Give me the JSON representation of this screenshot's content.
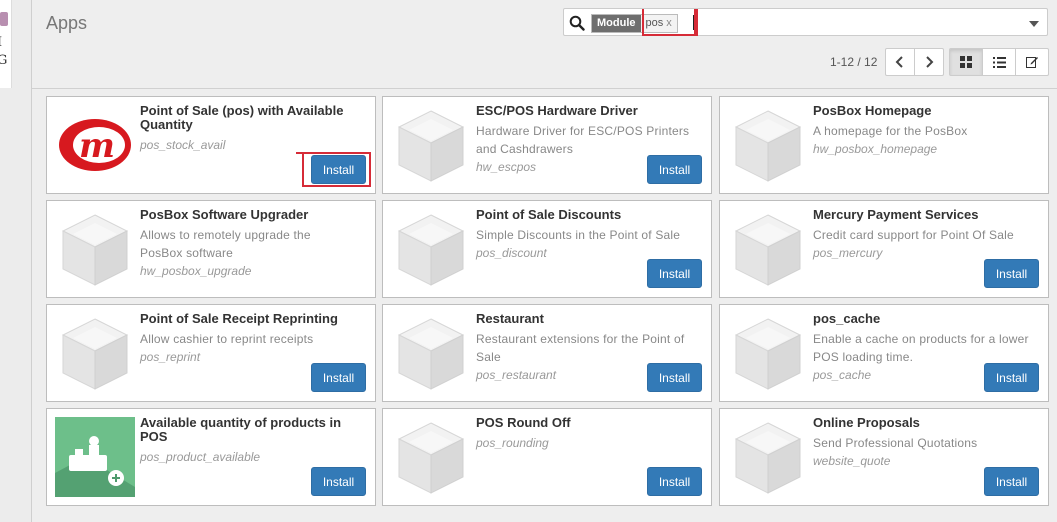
{
  "page": {
    "title": "Apps"
  },
  "search": {
    "facet_name": "Module",
    "facet_value": "pos",
    "facet_remove": "x",
    "input_value": ""
  },
  "pager": {
    "text": "1-12 / 12"
  },
  "colors": {
    "install_blue": "#337ab7",
    "highlight_red": "#d62b37"
  },
  "apps": [
    {
      "name": "Point of Sale (pos) with Available Quantity",
      "summary": "",
      "technical": "pos_stock_avail",
      "install": "Install",
      "icon": "m-logo-icon"
    },
    {
      "name": "ESC/POS Hardware Driver",
      "summary": "Hardware Driver for ESC/POS Printers and Cashdrawers",
      "technical": "hw_escpos",
      "install": "Install",
      "icon": "default-module-icon"
    },
    {
      "name": "PosBox Homepage",
      "summary": "A homepage for the PosBox",
      "technical": "hw_posbox_homepage",
      "install": "",
      "icon": "default-module-icon"
    },
    {
      "name": "PosBox Software Upgrader",
      "summary": "Allows to remotely upgrade the PosBox software",
      "technical": "hw_posbox_upgrade",
      "install": "",
      "icon": "default-module-icon"
    },
    {
      "name": "Point of Sale Discounts",
      "summary": "Simple Discounts in the Point of Sale",
      "technical": "pos_discount",
      "install": "Install",
      "icon": "default-module-icon"
    },
    {
      "name": "Mercury Payment Services",
      "summary": "Credit card support for Point Of Sale",
      "technical": "pos_mercury",
      "install": "Install",
      "icon": "default-module-icon"
    },
    {
      "name": "Point of Sale Receipt Reprinting",
      "summary": "Allow cashier to reprint receipts",
      "technical": "pos_reprint",
      "install": "Install",
      "icon": "default-module-icon"
    },
    {
      "name": "Restaurant",
      "summary": "Restaurant extensions for the Point of Sale",
      "technical": "pos_restaurant",
      "install": "Install",
      "icon": "default-module-icon"
    },
    {
      "name": "pos_cache",
      "summary": "Enable a cache on products for a lower POS loading time.",
      "technical": "pos_cache",
      "install": "Install",
      "icon": "default-module-icon"
    },
    {
      "name": "Available quantity of products in POS",
      "summary": "",
      "technical": "pos_product_available",
      "install": "Install",
      "icon": "product-available-icon"
    },
    {
      "name": "POS Round Off",
      "summary": "",
      "technical": "pos_rounding",
      "install": "Install",
      "icon": "default-module-icon"
    },
    {
      "name": "Online Proposals",
      "summary": "Send Professional Quotations",
      "technical": "website_quote",
      "install": "Install",
      "icon": "default-module-icon"
    }
  ]
}
